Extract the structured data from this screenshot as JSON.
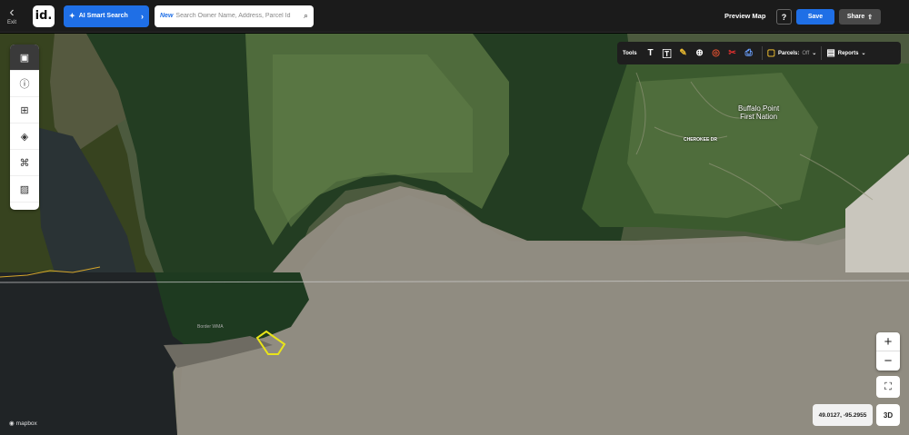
{
  "header": {
    "exit_label": "Exit",
    "logo_text": "id.",
    "ai_search_label": "AI Smart Search",
    "search_new_tag": "New",
    "search_placeholder": "Search Owner Name, Address, Parcel Id",
    "preview_map_label": "Preview Map",
    "help_label": "?",
    "save_label": "Save",
    "share_label": "Share"
  },
  "sidebar": {
    "items": [
      "panel-icon",
      "info-icon",
      "map-book-icon",
      "layers-icon",
      "hierarchy-icon",
      "image-icon"
    ],
    "active_index": 0
  },
  "toolbar": {
    "tools_label": "Tools",
    "tool_icons": [
      "text-icon",
      "text-box-icon",
      "ruler-icon",
      "globe-icon",
      "circle-icon",
      "scissors-icon",
      "printer-icon"
    ],
    "parcels_label": "Parcels:",
    "parcels_state": "Off",
    "reports_label": "Reports"
  },
  "map": {
    "place_label": "Buffalo Point\nFirst Nation",
    "road_label": "CHEROKEE DR",
    "area_label": "Border WMA",
    "attribution": "mapbox",
    "parcel_highlight_color": "#e9e41a"
  },
  "controls": {
    "zoom_in": "+",
    "zoom_out": "−",
    "coordinates": "49.0127, -95.2955",
    "view_3d": "3D"
  }
}
